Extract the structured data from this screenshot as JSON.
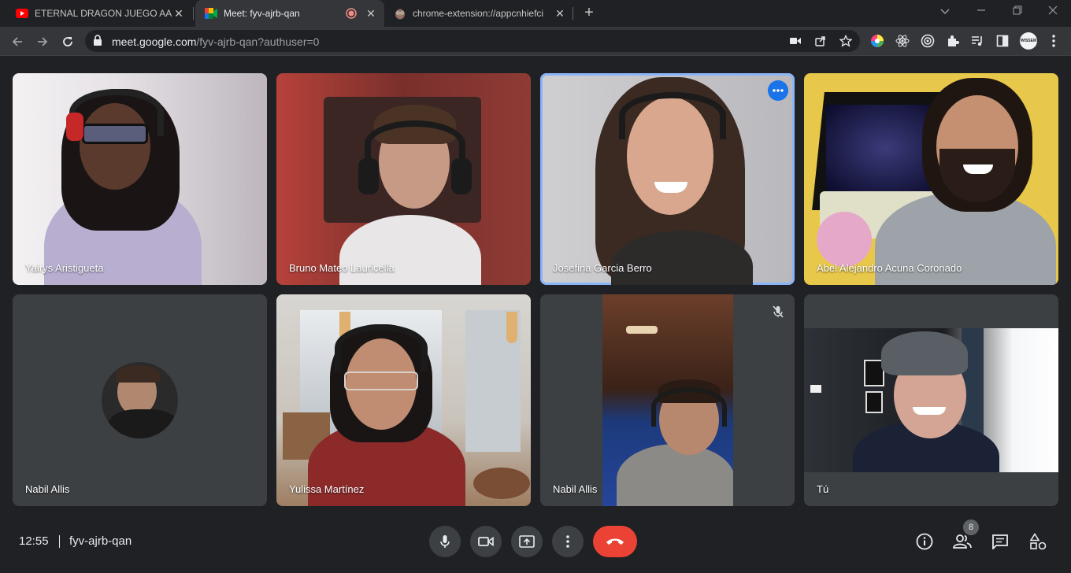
{
  "browser": {
    "tabs": [
      {
        "title": "ETERNAL DRAGON JUEGO AAA+",
        "favicon": "youtube-icon",
        "active": false
      },
      {
        "title": "Meet: fyv-ajrb-qan",
        "favicon": "meet-icon",
        "active": true,
        "recording": true
      },
      {
        "title": "chrome-extension://appcnhiefci",
        "favicon": "owl-extension-icon",
        "active": false
      }
    ],
    "url_host": "meet.google.com",
    "url_path": "/fyv-ajrb-qan?authuser=0",
    "profile_label": "WISSEM"
  },
  "participants": [
    {
      "name": "Yairys Aristigueta"
    },
    {
      "name": "Bruno Mateo Lauricella"
    },
    {
      "name": "Josefina Garcia Berro",
      "speaking": true
    },
    {
      "name": "Abel Alejandro Acuna Coronado"
    },
    {
      "name": "Nabil Allis",
      "camera": false
    },
    {
      "name": "Yulissa Martínez"
    },
    {
      "name": "Nabil Allis",
      "muted": true
    },
    {
      "name": "Tú"
    }
  ],
  "bottom_bar": {
    "time": "12:55",
    "meeting_code": "fyv-ajrb-qan",
    "participant_count": "8"
  },
  "colors": {
    "background": "#202124",
    "tile": "#3c4043",
    "speaking_border": "#8ab4f8",
    "leave_button": "#ea4335",
    "accent_blue": "#1a73e8"
  }
}
